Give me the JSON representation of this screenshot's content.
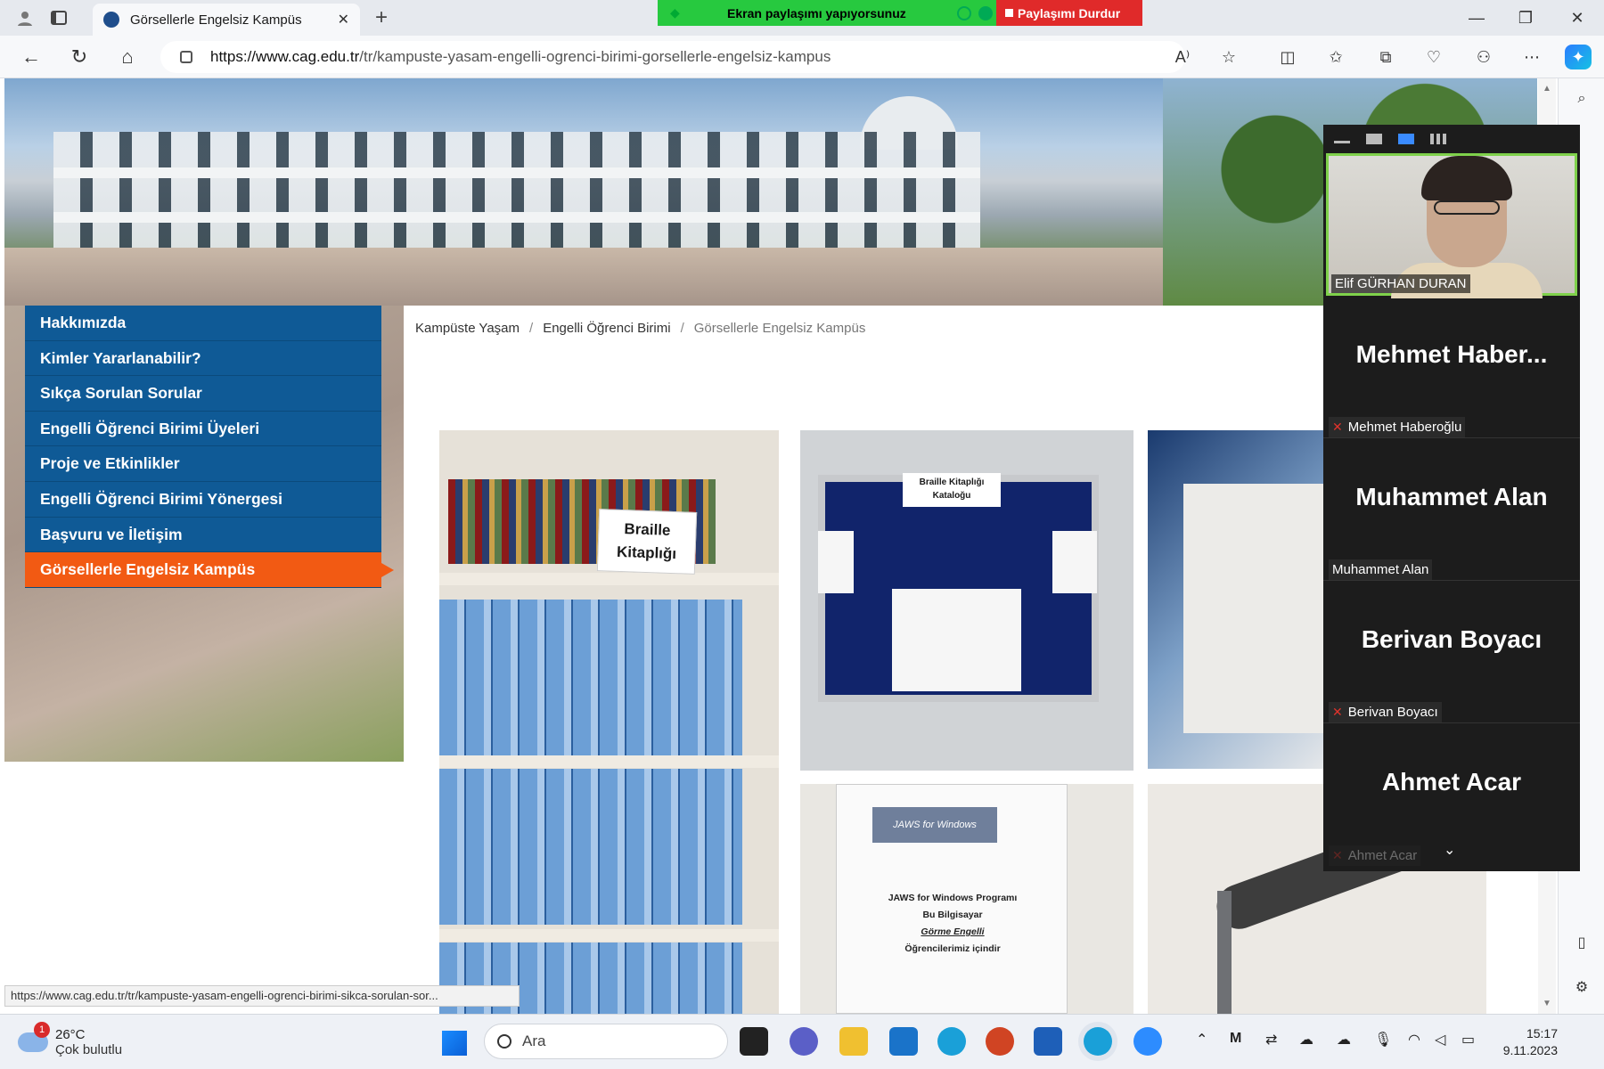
{
  "browser": {
    "tab_title": "Görsellerle Engelsiz Kampüs",
    "tab_close": "✕",
    "new_tab": "+",
    "url_domain": "https://www.cag.edu.tr",
    "url_path": "/tr/kampuste-yasam-engelli-ogrenci-birimi-gorsellerle-engelsiz-kampus",
    "status_url": "https://www.cag.edu.tr/tr/kampuste-yasam-engelli-ogrenci-birimi-sikca-sorulan-sor..."
  },
  "share_bar": {
    "label": "Ekran paylaşımı yapıyorsunuz",
    "stop_label": "Paylaşımı Durdur",
    "color": "#27c93f",
    "stop_color": "#e02a2a"
  },
  "menu": {
    "items": [
      {
        "label": "Hakkımızda"
      },
      {
        "label": "Kimler Yararlanabilir?"
      },
      {
        "label": "Sıkça Sorulan Sorular"
      },
      {
        "label": "Engelli Öğrenci Birimi Üyeleri"
      },
      {
        "label": "Proje ve Etkinlikler"
      },
      {
        "label": "Engelli Öğrenci Birimi Yönergesi"
      },
      {
        "label": "Başvuru ve İletişim"
      },
      {
        "label": "Görsellerle Engelsiz Kampüs"
      }
    ],
    "active_color": "#f25a13",
    "bg_color": "#0f5a96"
  },
  "breadcrumb": {
    "items": [
      "Kampüste Yaşam",
      "Engelli Öğrenci Birimi",
      "Görsellerle Engelsiz Kampüs"
    ],
    "separator": "/"
  },
  "photos": {
    "braille_sign_line1": "Braille",
    "braille_sign_line2": "Kitaplığı",
    "catalog_line1": "Braille Kitaplığı",
    "catalog_line2": "Kataloğu",
    "jaws_logo": "JAWS for Windows",
    "jaws_line1": "JAWS for Windows Programı",
    "jaws_line2": "Bu Bilgisayar",
    "jaws_line3": "Görme Engelli",
    "jaws_line4": "Öğrencilerimiz içindir"
  },
  "zoom_panel": {
    "self_name": "Elif GÜRHAN DURAN",
    "participants": [
      {
        "display": "Mehmet  Haber...",
        "name": "Mehmet Haberoğlu",
        "muted": true
      },
      {
        "display": "Muhammet Alan",
        "name": "Muhammet Alan",
        "muted": false
      },
      {
        "display": "Berivan Boyacı",
        "name": "Berivan Boyacı",
        "muted": true
      },
      {
        "display": "Ahmet Acar",
        "name": "Ahmet Acar",
        "muted": true
      }
    ]
  },
  "taskbar": {
    "weather_badge": "1",
    "temperature": "26°C",
    "weather_text": "Çok bulutlu",
    "search_placeholder": "Ara",
    "time": "15:17",
    "date": "9.11.2023"
  }
}
